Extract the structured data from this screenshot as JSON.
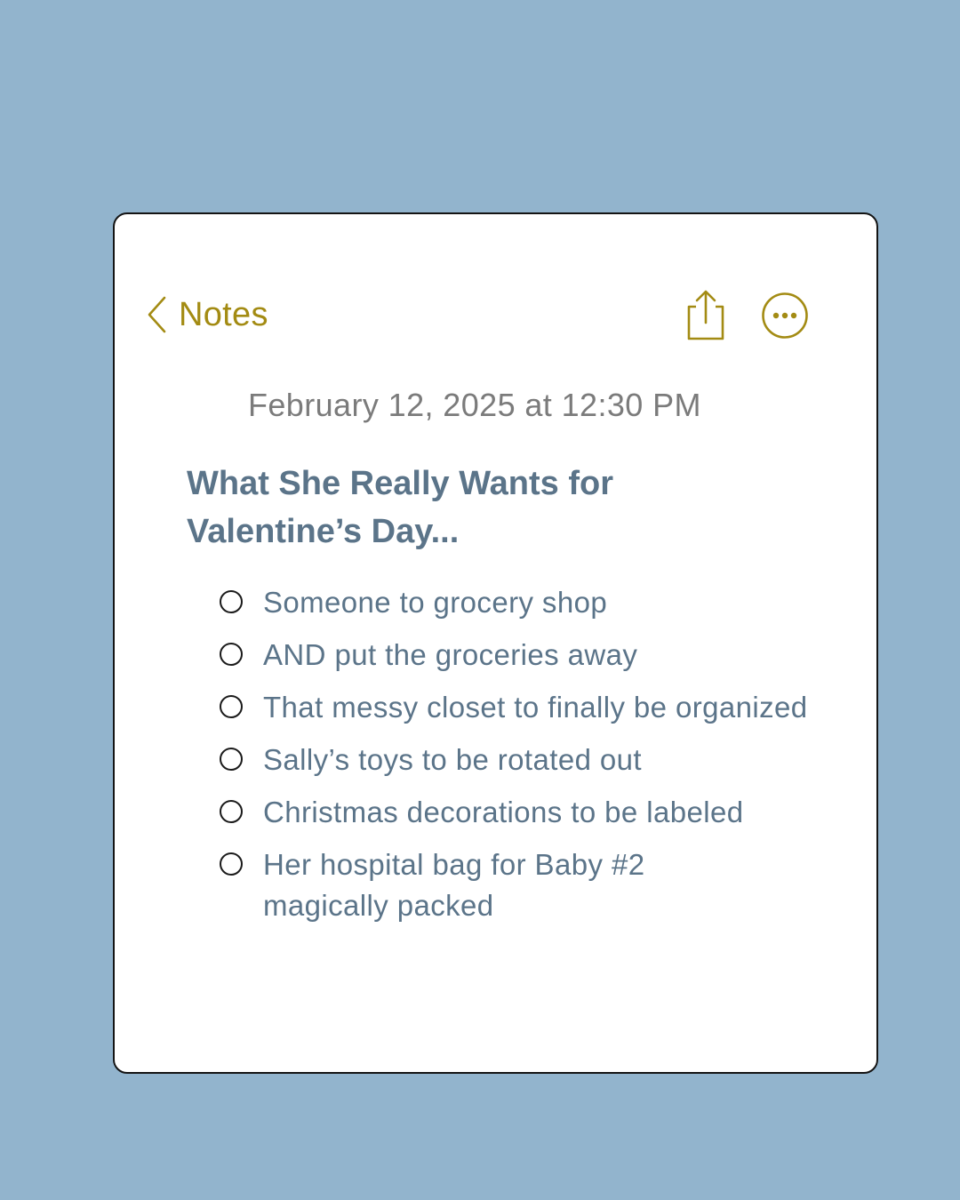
{
  "header": {
    "back_label": "Notes",
    "back_icon": "chevron-left-icon",
    "share_icon": "share-icon",
    "more_icon": "more-options-icon",
    "accent_color": "#a38b13"
  },
  "note": {
    "timestamp": "February 12, 2025 at 12:30 PM",
    "title": "What She Really Wants for Valentine’s Day...",
    "checklist": [
      {
        "text": "Someone to grocery shop",
        "checked": false
      },
      {
        "text": "AND put the groceries away",
        "checked": false
      },
      {
        "text": "That messy closet to finally be organized",
        "checked": false
      },
      {
        "text": "Sally’s toys to be rotated out",
        "checked": false
      },
      {
        "text": "Christmas decorations to be labeled",
        "checked": false
      },
      {
        "text": "Her hospital bag for Baby #2 magically packed",
        "checked": false
      }
    ]
  },
  "colors": {
    "background": "#92b4cd",
    "card": "#ffffff",
    "text": "#5b7489",
    "timestamp": "#7b7b7b"
  }
}
